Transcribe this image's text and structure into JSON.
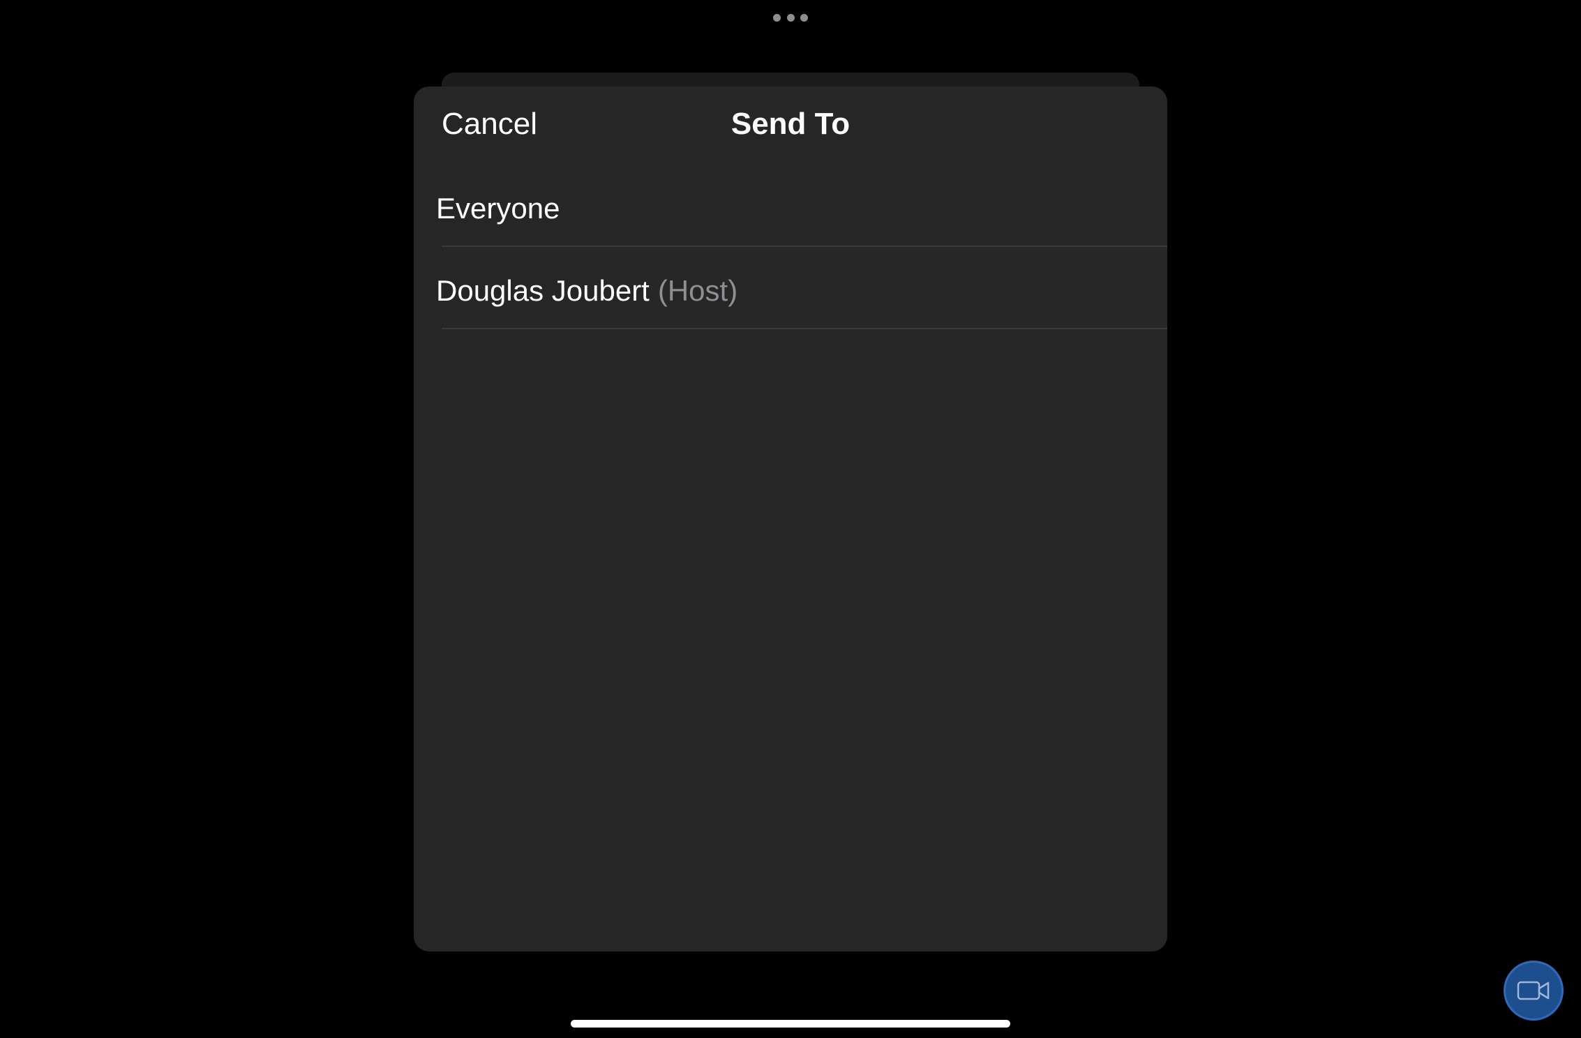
{
  "sheet": {
    "cancel_label": "Cancel",
    "title": "Send To"
  },
  "recipients": [
    {
      "name": "Everyone",
      "role": ""
    },
    {
      "name": "Douglas Joubert",
      "role": "(Host)"
    }
  ],
  "icons": {
    "multitask": "more-dots-icon",
    "video": "video-camera-icon"
  },
  "colors": {
    "background": "#000000",
    "sheet": "#262626",
    "primary_text": "#ffffff",
    "secondary_text": "#8e8e93",
    "video_button": "#1d4f8f"
  }
}
